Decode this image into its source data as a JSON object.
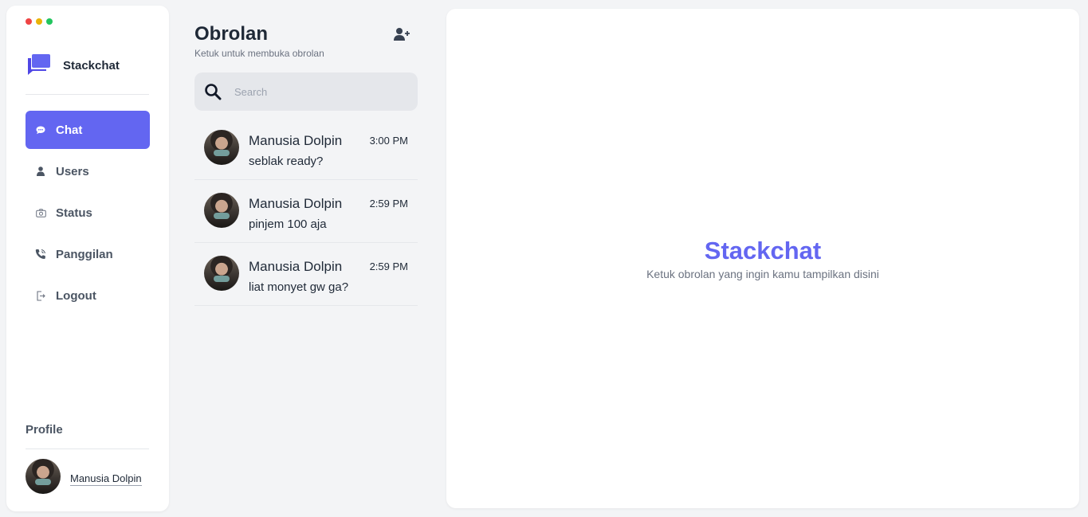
{
  "sidebar": {
    "brand": "Stackchat",
    "nav": [
      {
        "label": "Chat",
        "icon": "chat-bubble-icon",
        "active": true
      },
      {
        "label": "Users",
        "icon": "user-icon"
      },
      {
        "label": "Status",
        "icon": "camera-icon"
      },
      {
        "label": "Panggilan",
        "icon": "phone-icon"
      },
      {
        "label": "Logout",
        "icon": "logout-icon"
      }
    ],
    "profile_title": "Profile",
    "profile_name": "Manusia Dolpin"
  },
  "list": {
    "title": "Obrolan",
    "subtitle": "Ketuk untuk membuka obrolan",
    "search_placeholder": "Search",
    "chats": [
      {
        "name": "Manusia Dolpin",
        "message": "seblak ready?",
        "time": "3:00 PM"
      },
      {
        "name": "Manusia Dolpin",
        "message": "pinjem 100 aja",
        "time": "2:59 PM"
      },
      {
        "name": "Manusia Dolpin",
        "message": "liat monyet gw ga?",
        "time": "2:59 PM"
      }
    ]
  },
  "main": {
    "title": "Stackchat",
    "subtitle": "Ketuk obrolan yang ingin kamu tampilkan disini"
  },
  "colors": {
    "accent": "#6366f1",
    "background": "#f3f4f6",
    "panel": "#ffffff"
  }
}
